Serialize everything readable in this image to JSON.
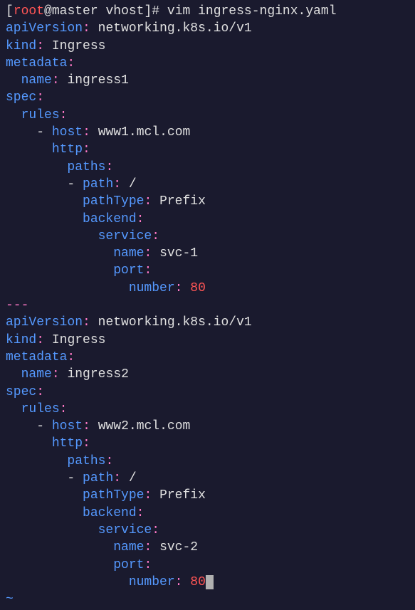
{
  "prompt": {
    "open": "[",
    "user": "root",
    "at": "@",
    "host": "master",
    "space": " ",
    "path": "vhost",
    "close": "]#",
    "command": " vim ingress-nginx.yaml"
  },
  "doc1": {
    "apiVersion": {
      "key": "apiVersion",
      "value": "networking.k8s.io/v1"
    },
    "kind": {
      "key": "kind",
      "value": "Ingress"
    },
    "metadata": {
      "key": "metadata"
    },
    "name": {
      "key": "name",
      "value": "ingress1"
    },
    "spec": {
      "key": "spec"
    },
    "rules": {
      "key": "rules"
    },
    "host": {
      "key": "host",
      "value": "www1.mcl.com"
    },
    "http": {
      "key": "http"
    },
    "paths": {
      "key": "paths"
    },
    "path": {
      "key": "path",
      "value": "/"
    },
    "pathType": {
      "key": "pathType",
      "value": "Prefix"
    },
    "backend": {
      "key": "backend"
    },
    "service": {
      "key": "service"
    },
    "svcName": {
      "key": "name",
      "value": "svc-1"
    },
    "port": {
      "key": "port"
    },
    "number": {
      "key": "number",
      "value": "80"
    }
  },
  "separator": "---",
  "doc2": {
    "apiVersion": {
      "key": "apiVersion",
      "value": "networking.k8s.io/v1"
    },
    "kind": {
      "key": "kind",
      "value": "Ingress"
    },
    "metadata": {
      "key": "metadata"
    },
    "name": {
      "key": "name",
      "value": "ingress2"
    },
    "spec": {
      "key": "spec"
    },
    "rules": {
      "key": "rules"
    },
    "host": {
      "key": "host",
      "value": "www2.mcl.com"
    },
    "http": {
      "key": "http"
    },
    "paths": {
      "key": "paths"
    },
    "path": {
      "key": "path",
      "value": "/"
    },
    "pathType": {
      "key": "pathType",
      "value": "Prefix"
    },
    "backend": {
      "key": "backend"
    },
    "service": {
      "key": "service"
    },
    "svcName": {
      "key": "name",
      "value": "svc-2"
    },
    "port": {
      "key": "port"
    },
    "number": {
      "key": "number",
      "value": "80"
    }
  },
  "vim": {
    "tilde": "~"
  }
}
